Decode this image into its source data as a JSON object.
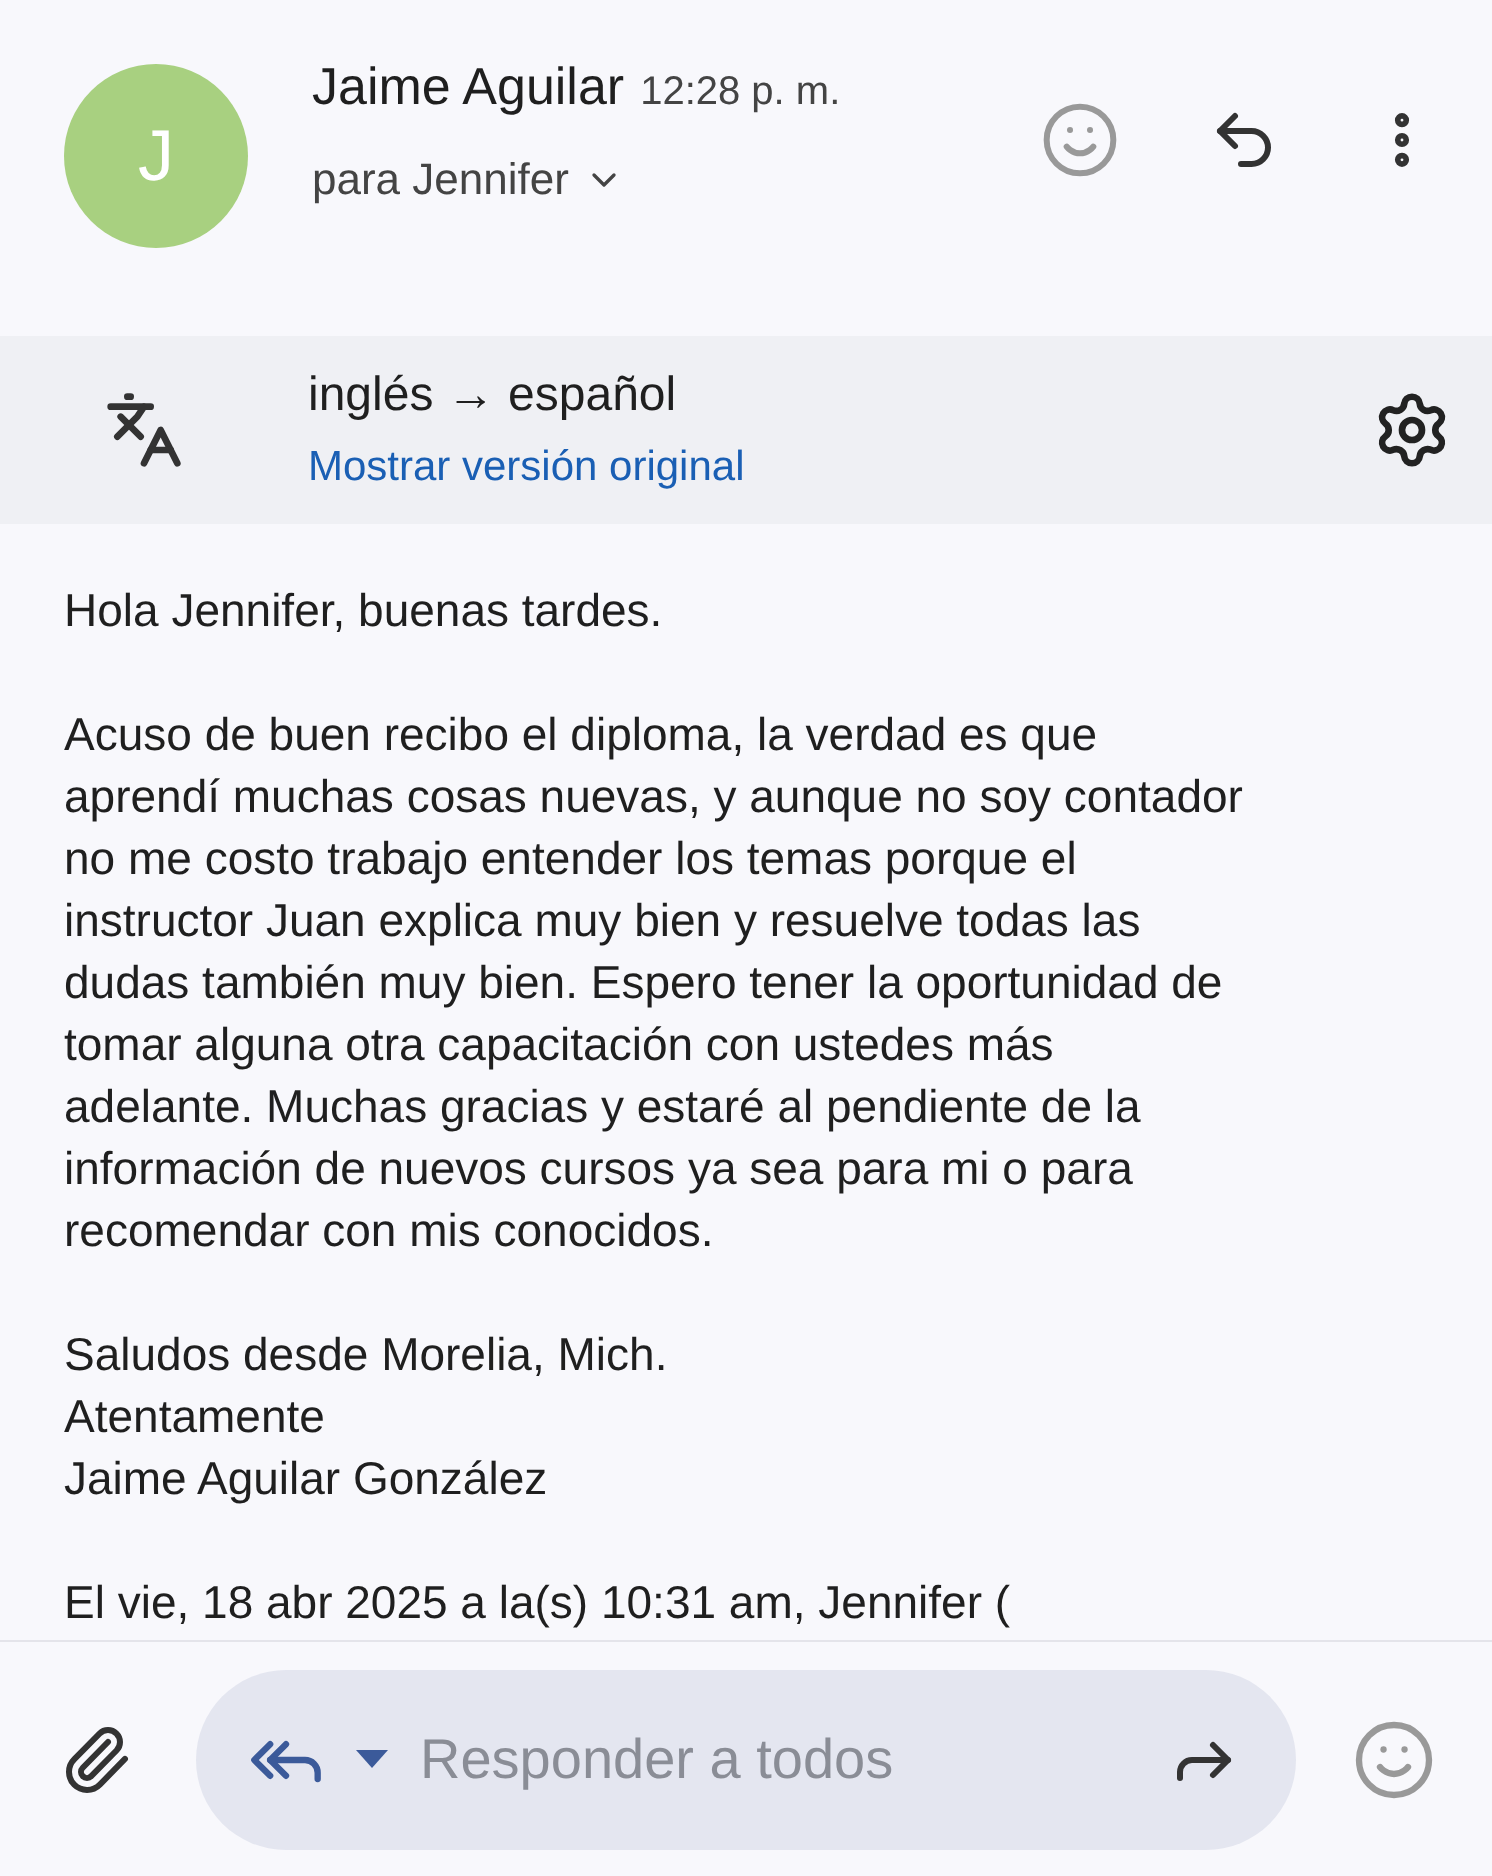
{
  "header": {
    "avatar_letter": "J",
    "sender": "Jaime Aguilar",
    "time": "12:28 p. m.",
    "recipient": "para Jennifer"
  },
  "translation": {
    "languages": "inglés → español",
    "link": "Mostrar versión original"
  },
  "body": [
    {
      "lines": [
        "Hola Jennifer, buenas tardes."
      ]
    },
    {
      "lines": [
        "Acuso de buen recibo el diploma, la verdad es que",
        "aprendí muchas cosas nuevas, y aunque no soy contador",
        "no me costo trabajo entender los temas porque el",
        "instructor Juan explica muy bien y resuelve todas las",
        "dudas también muy bien. Espero tener la oportunidad de",
        "tomar alguna otra capacitación con ustedes más",
        "adelante. Muchas gracias y estaré al pendiente de la",
        "información de nuevos cursos ya sea para mi o para",
        "recomendar con mis conocidos."
      ]
    },
    {
      "lines": [
        "Saludos desde Morelia, Mich.",
        "Atentamente",
        "Jaime Aguilar González"
      ]
    },
    {
      "lines": [
        "El vie, 18 abr 2025 a la(s) 10:31 am, Jennifer ("
      ]
    }
  ],
  "reply_bar": {
    "placeholder": "Responder a todos"
  }
}
